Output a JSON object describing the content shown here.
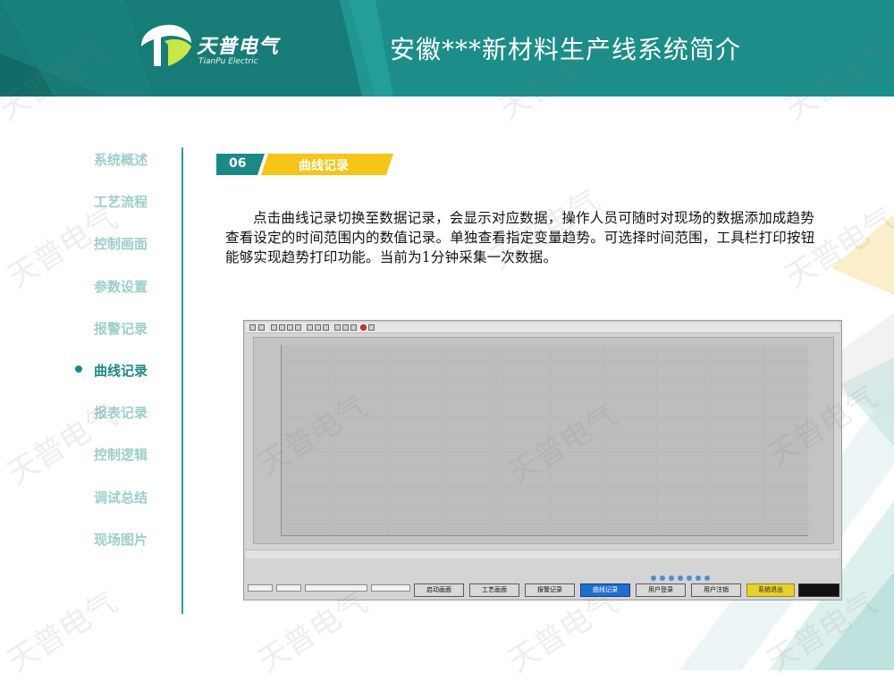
{
  "header": {
    "logo_brand": "天普电气",
    "logo_sub": "TianPu Electric",
    "title": "安徽***新材料生产线系统简介"
  },
  "sidebar": {
    "items": [
      {
        "label": "系统概述"
      },
      {
        "label": "工艺流程"
      },
      {
        "label": "控制画面"
      },
      {
        "label": "参数设置"
      },
      {
        "label": "报警记录"
      },
      {
        "label": "曲线记录",
        "active": true
      },
      {
        "label": "报表记录"
      },
      {
        "label": "控制逻辑"
      },
      {
        "label": "调试总结"
      },
      {
        "label": "现场图片"
      }
    ]
  },
  "section": {
    "number": "06",
    "label": "曲线记录"
  },
  "body_text": "点击曲线记录切换至数据记录，会显示对应数据，操作人员可随时对现场的数据添加成趋势查看设定的时间范围内的数值记录。单独查看指定变量趋势。可选择时间范围，工具栏打印按钮能够实现趋势打印功能。当前为1分钟采集一次数据。",
  "screenshot": {
    "nav_buttons": [
      {
        "label": "启动画面"
      },
      {
        "label": "工艺画面"
      },
      {
        "label": "报警记录"
      },
      {
        "label": "曲线记录",
        "active": true
      },
      {
        "label": "用户登录"
      },
      {
        "label": "用户注销"
      },
      {
        "label": "系统退出",
        "style": "yellow"
      }
    ]
  },
  "watermark": "天普电气",
  "colors": {
    "teal": "#1b8a86",
    "teal_light": "#9ccfcb",
    "yellow": "#f5c518",
    "header_dark": "#1a8782"
  }
}
